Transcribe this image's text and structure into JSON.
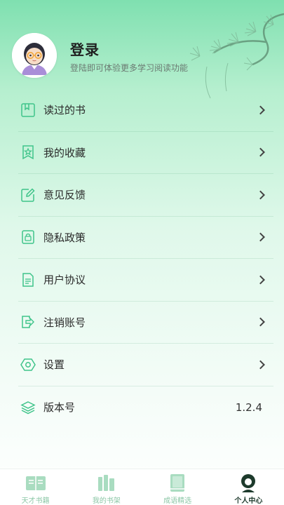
{
  "profile": {
    "login_title": "登录",
    "login_subtitle": "登陆即可体验更多学习阅读功能"
  },
  "menu": [
    {
      "label": "读过的书",
      "icon": "book-icon"
    },
    {
      "label": "我的收藏",
      "icon": "bookmark-star-icon"
    },
    {
      "label": "意见反馈",
      "icon": "edit-icon"
    },
    {
      "label": "隐私政策",
      "icon": "lock-document-icon"
    },
    {
      "label": "用户协议",
      "icon": "document-icon"
    },
    {
      "label": "注销账号",
      "icon": "logout-icon"
    },
    {
      "label": "设置",
      "icon": "settings-hexagon-icon"
    },
    {
      "label": "版本号",
      "icon": "layers-icon",
      "value": "1.2.4"
    }
  ],
  "tabs": [
    {
      "label": "天才书籍",
      "icon": "open-book-icon",
      "active": false
    },
    {
      "label": "我的书架",
      "icon": "bookshelf-icon",
      "active": false
    },
    {
      "label": "成语精选",
      "icon": "idiom-book-icon",
      "active": false
    },
    {
      "label": "个人中心",
      "icon": "profile-icon",
      "active": true
    }
  ],
  "colors": {
    "accent": "#3fc48a",
    "tab_inactive": "#8bc7a6",
    "tab_active": "#1d3a2c"
  }
}
